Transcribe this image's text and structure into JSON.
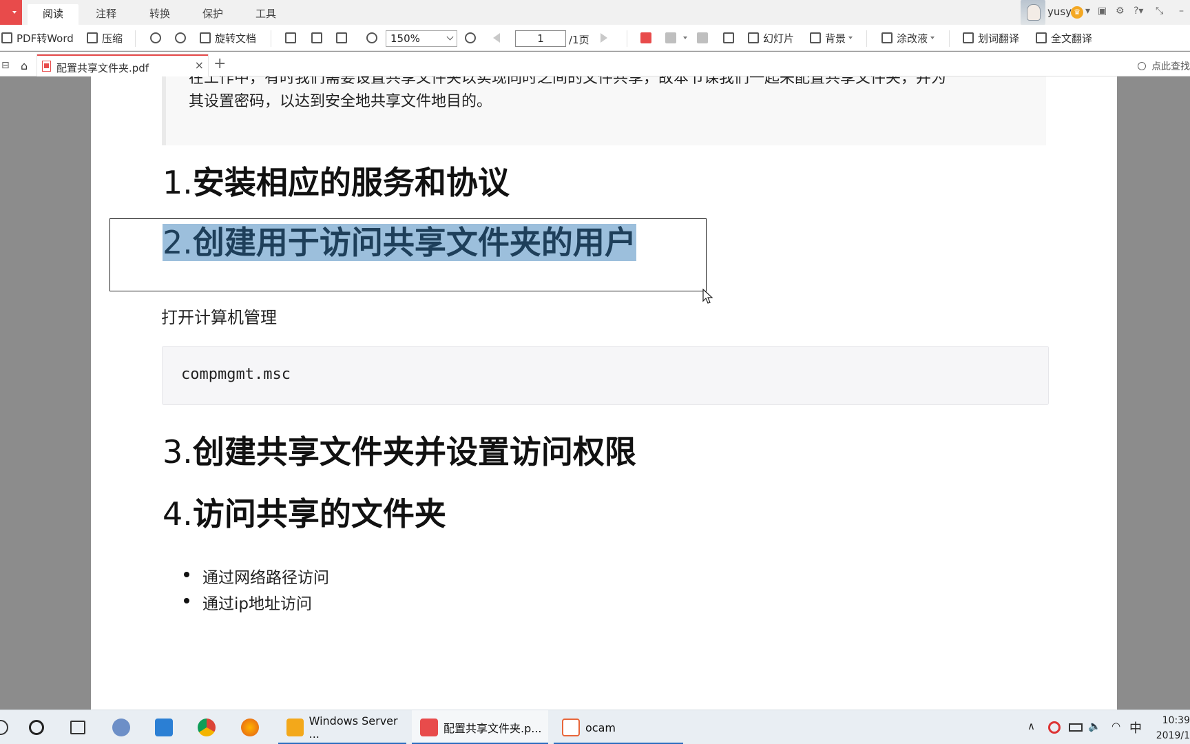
{
  "menu": {
    "tabs": [
      "阅读",
      "注释",
      "转换",
      "保护",
      "工具"
    ],
    "active_tab": "阅读",
    "username": "yusy"
  },
  "toolbar": {
    "pdf_to_word": "PDF转Word",
    "compress": "压缩",
    "rotate_doc": "旋转文档",
    "zoom": "150%",
    "page_current": "1",
    "page_total": "/1页",
    "slideshow": "幻灯片",
    "background": "背景",
    "correction_fluid": "涂改液",
    "word_translate": "划词翻译",
    "full_translate": "全文翻译"
  },
  "tabbar": {
    "doc_name": "配置共享文件夹.pdf",
    "close": "×",
    "add": "+",
    "search_placeholder": "点此查找"
  },
  "document": {
    "intro_line1": "在工作中，有时我们需要设置共享文件夹以实现同时之间的文件共享，故本节课我们一起来配置共享文件夹，并为",
    "intro_line2": "其设置密码，以达到安全地共享文件地目的。",
    "headings": [
      {
        "num": "1.",
        "text": "安装相应的服务和协议"
      },
      {
        "num": "2.",
        "text": "创建用于访问共享文件夹的用户"
      },
      {
        "num": "3.",
        "text": "创建共享文件夹并设置访问权限"
      },
      {
        "num": "4.",
        "text": "访问共享的文件夹"
      }
    ],
    "open_mgmt": "打开计算机管理",
    "code": "compmgmt.msc",
    "bullets": [
      "通过网络路径访问",
      "通过ip地址访问"
    ]
  },
  "taskbar": {
    "apps": [
      {
        "label": "Windows Server ..."
      },
      {
        "label": "配置共享文件夹.p..."
      },
      {
        "label": "ocam"
      }
    ],
    "ime": "中",
    "time": "10:39",
    "date": "2019/1"
  },
  "colors": {
    "accent": "#e84b4b",
    "selection": "#9cbfdc",
    "taskbar_accent": "#2a6cbf"
  }
}
